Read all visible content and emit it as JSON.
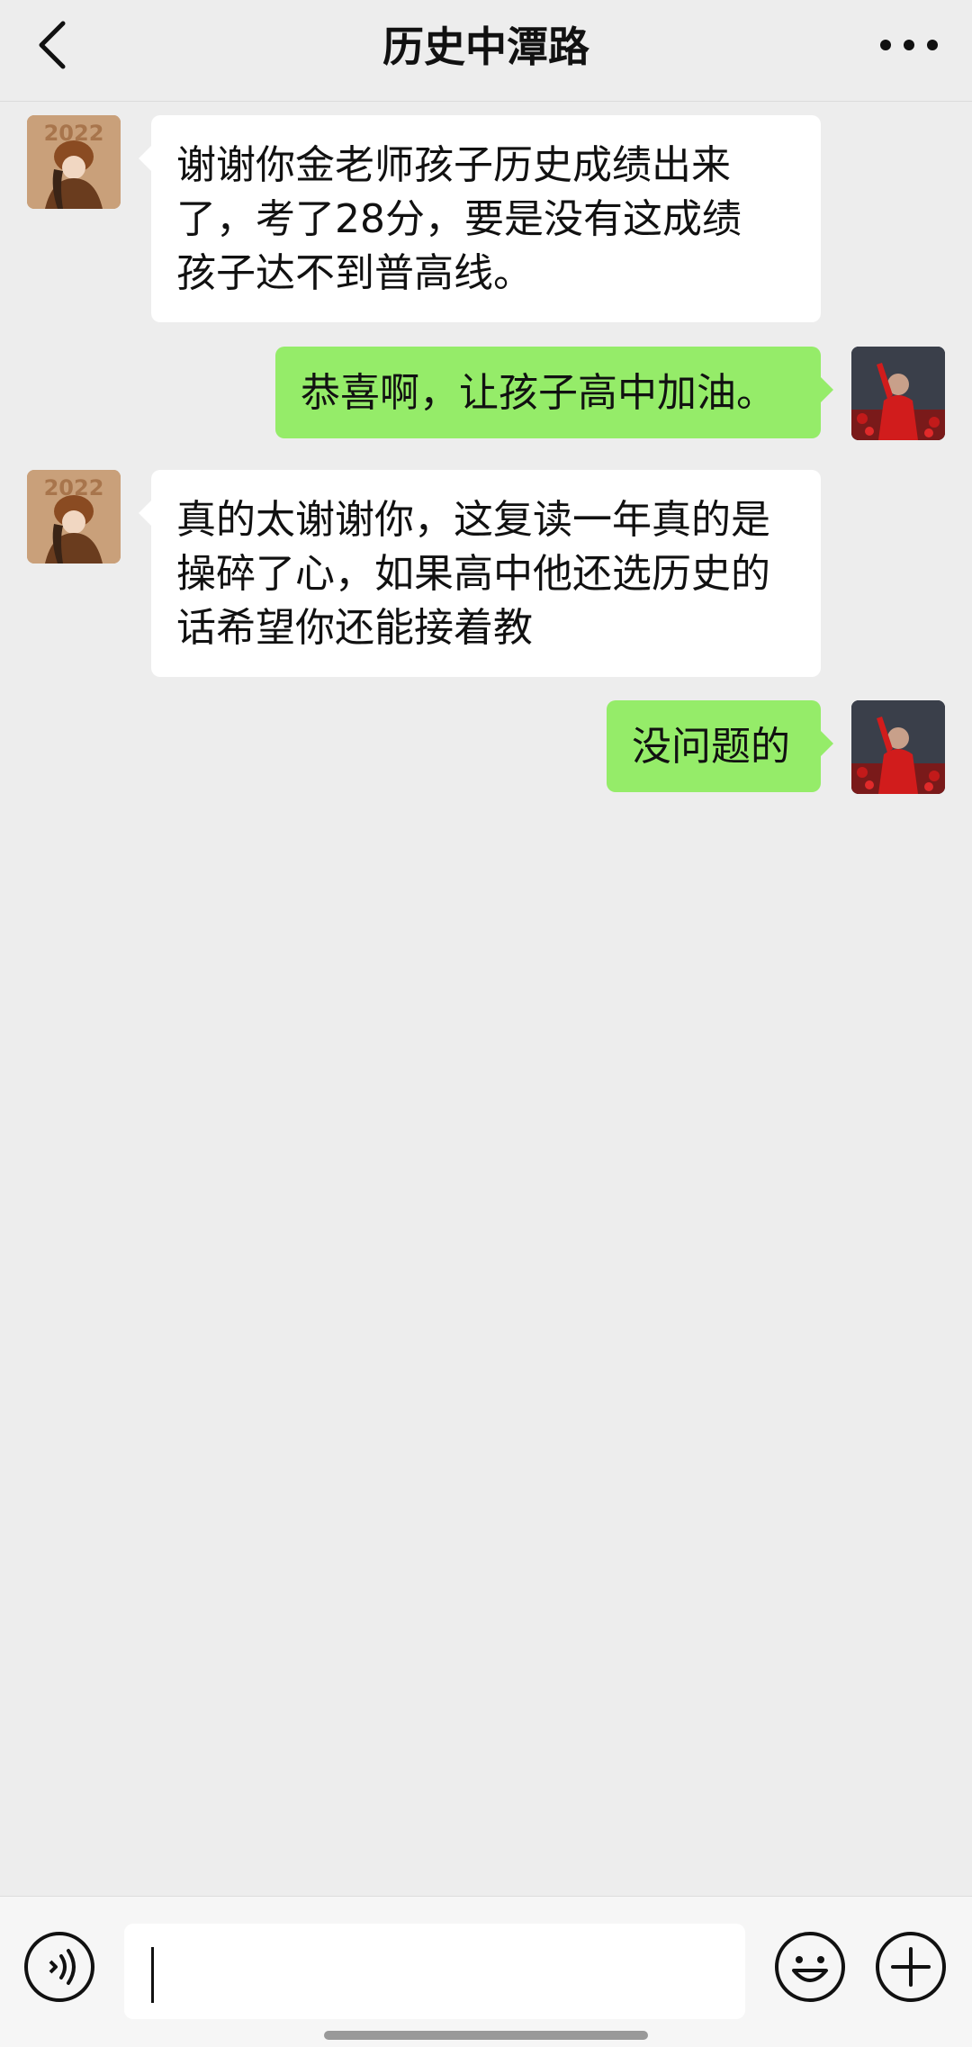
{
  "header": {
    "title": "历史中潭路",
    "back_icon": "chevron-left-icon",
    "more_icon": "more-dots-icon"
  },
  "messages": [
    {
      "side": "left",
      "text": "谢谢你金老师孩子历史成绩出来\n了，考了28分，要是没有这成绩\n孩子达不到普高线。"
    },
    {
      "side": "right",
      "text": "恭喜啊，让孩子高中加油。"
    },
    {
      "side": "left",
      "text": "真的太谢谢你，这复读一年真的是\n操碎了心，如果高中他还选历史的\n话希望你还能接着教"
    },
    {
      "side": "right",
      "text": "没问题的"
    }
  ],
  "avatars": {
    "left_badge": "2022"
  },
  "input_bar": {
    "voice_icon": "voice-icon",
    "emoji_icon": "emoji-icon",
    "add_icon": "plus-icon",
    "input_value": ""
  },
  "colors": {
    "background": "#ededed",
    "bubble_right": "#95ec69",
    "bubble_left": "#ffffff"
  }
}
